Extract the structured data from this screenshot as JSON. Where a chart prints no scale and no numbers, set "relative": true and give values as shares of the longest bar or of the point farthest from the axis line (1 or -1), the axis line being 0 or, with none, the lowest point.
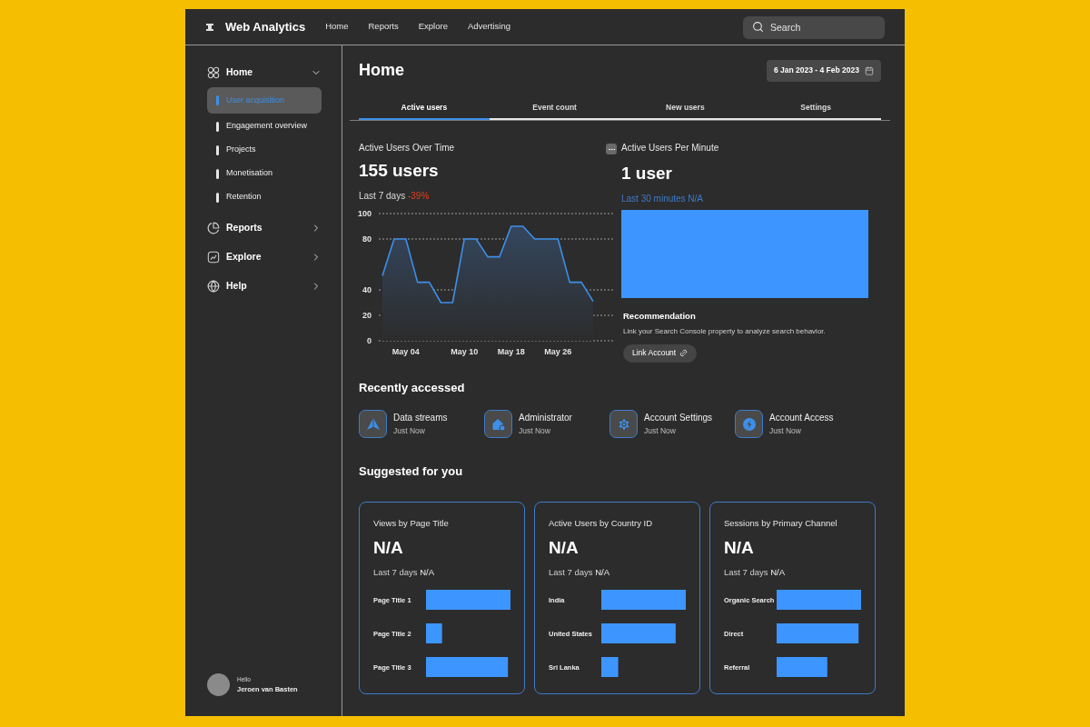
{
  "app": {
    "title": "Web Analytics"
  },
  "top_nav": [
    {
      "label": "Home"
    },
    {
      "label": "Reports"
    },
    {
      "label": "Explore"
    },
    {
      "label": "Advertising"
    }
  ],
  "search": {
    "placeholder": "Search"
  },
  "sidebar": {
    "items": [
      {
        "label": "Home",
        "expanded": true,
        "children": [
          {
            "label": "User acquisition",
            "selected": true
          },
          {
            "label": "Engagement overview",
            "selected": false
          },
          {
            "label": "Projects",
            "selected": false
          },
          {
            "label": "Monetisation",
            "selected": false
          },
          {
            "label": "Retention",
            "selected": false
          }
        ]
      },
      {
        "label": "Reports",
        "expanded": false
      },
      {
        "label": "Explore",
        "expanded": false
      },
      {
        "label": "Help",
        "expanded": false
      }
    ],
    "user": {
      "greeting": "Hello",
      "name": "Jeroen van Basten"
    }
  },
  "page": {
    "title": "Home",
    "date_range": "6 Jan 2023 - 4 Feb 2023"
  },
  "tabs": [
    {
      "label": "Active users",
      "selected": true
    },
    {
      "label": "Event count",
      "selected": false
    },
    {
      "label": "New users",
      "selected": false
    },
    {
      "label": "Settings",
      "selected": false
    }
  ],
  "active_users": {
    "title": "Active Users Over Time",
    "value": "155 users",
    "period": "Last 7 days",
    "change": "-39%",
    "chart_data": {
      "type": "area",
      "categories": [
        null,
        null,
        "May 04",
        null,
        null,
        null,
        null,
        "May 10",
        null,
        null,
        null,
        "May 18",
        null,
        null,
        null,
        "May 26",
        null,
        null,
        null
      ],
      "series": [
        {
          "color": "#3d8fe8",
          "values": [
            51,
            80,
            80,
            46,
            46,
            30,
            30,
            80,
            80,
            66,
            66,
            90,
            90,
            80,
            80,
            80,
            46,
            46,
            31
          ]
        }
      ],
      "ylim": [
        0,
        100
      ],
      "yticks": [
        0,
        20,
        40,
        80,
        100
      ],
      "grid": true
    }
  },
  "per_minute": {
    "title": "Active Users Per Minute",
    "value": "1 user",
    "period": "Last 30 minutes N/A",
    "recommendation": {
      "title": "Recommendation",
      "text": "Link your Search Console property to analyze search behavior.",
      "button": "Link Account"
    }
  },
  "recently_accessed": {
    "title": "Recently accessed",
    "items": [
      {
        "kind": "streams",
        "label": "Data streams",
        "time": "Just Now"
      },
      {
        "kind": "admin",
        "label": "Administrator",
        "time": "Just Now"
      },
      {
        "kind": "settings",
        "label": "Account Settings",
        "time": "Just Now"
      },
      {
        "kind": "access",
        "label": "Account Access",
        "time": "Just Now"
      }
    ]
  },
  "suggested": {
    "title": "Suggested for you",
    "cards": [
      {
        "title": "Views by Page Title",
        "value": "N/A",
        "period": "Last 7 days",
        "change": "N/A",
        "chart_data": {
          "type": "bar",
          "orientation": "horizontal",
          "relative": true,
          "categories": [
            "Page Title 1",
            "Page Title 2",
            "Page Title 3"
          ],
          "values": [
            1.0,
            0.19,
            0.97
          ]
        }
      },
      {
        "title": "Active Users by Country ID",
        "value": "N/A",
        "period": "Last 7 days",
        "change": "N/A",
        "chart_data": {
          "type": "bar",
          "orientation": "horizontal",
          "relative": true,
          "categories": [
            "India",
            "United States",
            "Sri Lanka"
          ],
          "values": [
            1.0,
            0.88,
            0.2
          ]
        }
      },
      {
        "title": "Sessions by Primary Channel",
        "value": "N/A",
        "period": "Last 7 days",
        "change": "N/A",
        "chart_data": {
          "type": "bar",
          "orientation": "horizontal",
          "relative": true,
          "categories": [
            "Organic Search",
            "Direct",
            "Referral"
          ],
          "values": [
            1.0,
            0.97,
            0.6
          ]
        }
      }
    ]
  }
}
